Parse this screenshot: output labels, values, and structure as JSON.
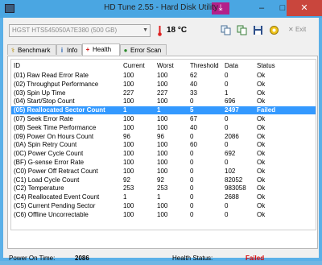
{
  "title": "HD Tune 2.55 - Hard Disk Utility",
  "window_controls": {
    "minimize": "–",
    "maximize": "□",
    "close": "✕"
  },
  "download_icon": "⤓",
  "disk_label": "HGST   HTS545050A7E380 (500 GB)",
  "temperature": "18 °C",
  "exit_label": "Exit",
  "tabs": [
    {
      "label": "Benchmark",
      "icon": "⚕"
    },
    {
      "label": "Info",
      "icon": "i"
    },
    {
      "label": "Health",
      "icon": "+"
    },
    {
      "label": "Error Scan",
      "icon": "●"
    }
  ],
  "columns": [
    "ID",
    "Current",
    "Worst",
    "Threshold",
    "Data",
    "Status"
  ],
  "rows": [
    {
      "id": "(01) Raw Read Error Rate",
      "cur": "100",
      "worst": "100",
      "thr": "62",
      "data": "0",
      "status": "Ok"
    },
    {
      "id": "(02) Throughput Performance",
      "cur": "100",
      "worst": "100",
      "thr": "40",
      "data": "0",
      "status": "Ok"
    },
    {
      "id": "(03) Spin Up Time",
      "cur": "227",
      "worst": "227",
      "thr": "33",
      "data": "1",
      "status": "Ok"
    },
    {
      "id": "(04) Start/Stop Count",
      "cur": "100",
      "worst": "100",
      "thr": "0",
      "data": "696",
      "status": "Ok"
    },
    {
      "id": "(05) Reallocated Sector Count",
      "cur": "1",
      "worst": "1",
      "thr": "5",
      "data": "2497",
      "status": "Failed"
    },
    {
      "id": "(07) Seek Error Rate",
      "cur": "100",
      "worst": "100",
      "thr": "67",
      "data": "0",
      "status": "Ok"
    },
    {
      "id": "(08) Seek Time Performance",
      "cur": "100",
      "worst": "100",
      "thr": "40",
      "data": "0",
      "status": "Ok"
    },
    {
      "id": "(09) Power On Hours Count",
      "cur": "96",
      "worst": "96",
      "thr": "0",
      "data": "2086",
      "status": "Ok"
    },
    {
      "id": "(0A) Spin Retry Count",
      "cur": "100",
      "worst": "100",
      "thr": "60",
      "data": "0",
      "status": "Ok"
    },
    {
      "id": "(0C) Power Cycle Count",
      "cur": "100",
      "worst": "100",
      "thr": "0",
      "data": "692",
      "status": "Ok"
    },
    {
      "id": "(BF) G-sense Error Rate",
      "cur": "100",
      "worst": "100",
      "thr": "0",
      "data": "0",
      "status": "Ok"
    },
    {
      "id": "(C0) Power Off Retract Count",
      "cur": "100",
      "worst": "100",
      "thr": "0",
      "data": "102",
      "status": "Ok"
    },
    {
      "id": "(C1) Load Cycle Count",
      "cur": "92",
      "worst": "92",
      "thr": "0",
      "data": "82052",
      "status": "Ok"
    },
    {
      "id": "(C2) Temperature",
      "cur": "253",
      "worst": "253",
      "thr": "0",
      "data": "983058",
      "status": "Ok"
    },
    {
      "id": "(C4) Reallocated Event Count",
      "cur": "1",
      "worst": "1",
      "thr": "0",
      "data": "2688",
      "status": "Ok"
    },
    {
      "id": "(C5) Current Pending Sector",
      "cur": "100",
      "worst": "100",
      "thr": "0",
      "data": "0",
      "status": "Ok"
    },
    {
      "id": "(C6) Offline Uncorrectable",
      "cur": "100",
      "worst": "100",
      "thr": "0",
      "data": "0",
      "status": "Ok"
    }
  ],
  "footer": {
    "power_on_label": "Power On Time:",
    "power_on_value": "2086",
    "health_label": "Health Status:",
    "health_value": "Failed"
  },
  "colors": {
    "selected_row": "#3399ff",
    "failed_text": "#d60000",
    "title_bar": "#4aa6e2"
  }
}
